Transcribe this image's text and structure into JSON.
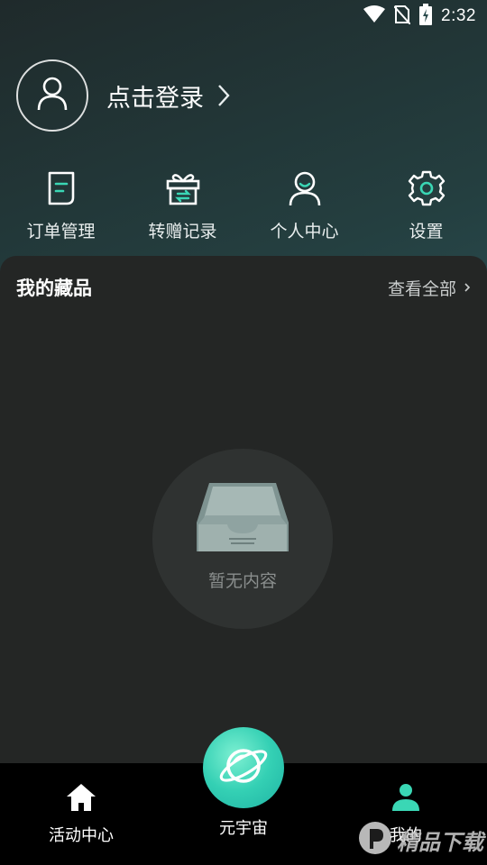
{
  "status_bar": {
    "time": "2:32"
  },
  "profile": {
    "login_text": "点击登录"
  },
  "quick_menu": [
    {
      "label": "订单管理",
      "icon": "order-icon"
    },
    {
      "label": "转赠记录",
      "icon": "gift-icon"
    },
    {
      "label": "个人中心",
      "icon": "user-center-icon"
    },
    {
      "label": "设置",
      "icon": "gear-icon"
    }
  ],
  "collection": {
    "title": "我的藏品",
    "view_all": "查看全部",
    "empty_text": "暂无内容"
  },
  "bottom_nav": {
    "home": "活动中心",
    "metaverse": "元宇宙",
    "mine": "我的"
  },
  "watermark": {
    "text": "精品下载"
  },
  "colors": {
    "accent": "#3ad7b5",
    "panel": "#242625",
    "nav": "#000000"
  }
}
